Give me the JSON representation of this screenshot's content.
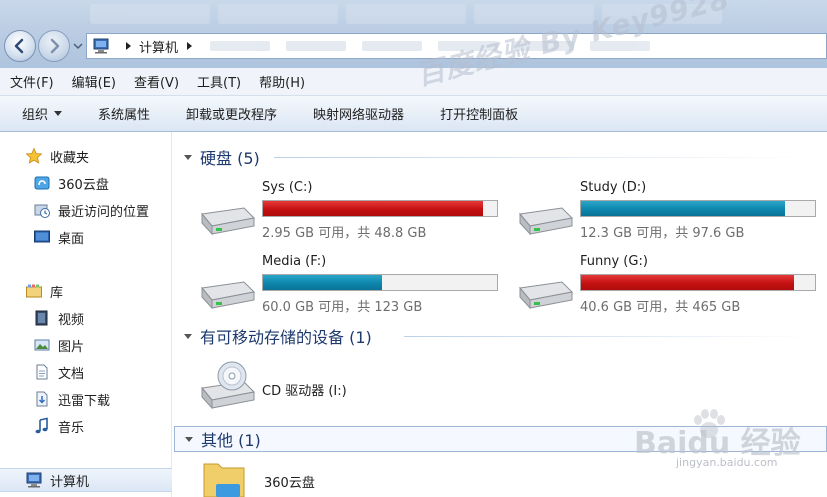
{
  "window": {
    "address": {
      "location": "计算机"
    }
  },
  "menu": [
    "文件(F)",
    "编辑(E)",
    "查看(V)",
    "工具(T)",
    "帮助(H)"
  ],
  "commands": {
    "organize": "组织",
    "system_properties": "系统属性",
    "uninstall": "卸载或更改程序",
    "map_drive": "映射网络驱动器",
    "control_panel": "打开控制面板"
  },
  "nav": {
    "favorites": {
      "label": "收藏夹",
      "items": [
        "360云盘",
        "最近访问的位置",
        "桌面"
      ]
    },
    "libraries": {
      "label": "库",
      "items": [
        "视频",
        "图片",
        "文档",
        "迅雷下载",
        "音乐"
      ]
    },
    "computer": "计算机"
  },
  "groups": {
    "hard_disks": {
      "title": "硬盘 (5)",
      "drives": [
        {
          "name": "Sys (C:)",
          "info": "2.95 GB 可用，共 48.8 GB",
          "used_fraction": 0.94,
          "color": "red"
        },
        {
          "name": "Study (D:)",
          "info": "12.3 GB 可用，共 97.6 GB",
          "used_fraction": 0.87,
          "color": "teal"
        },
        {
          "name": "Media (F:)",
          "info": "60.0 GB 可用，共 123 GB",
          "used_fraction": 0.51,
          "color": "teal"
        },
        {
          "name": "Funny (G:)",
          "info": "40.6 GB 可用，共 465 GB",
          "used_fraction": 0.91,
          "color": "red"
        }
      ]
    },
    "removable": {
      "title": "有可移动存储的设备 (1)",
      "item": "CD 驱动器 (I:)"
    },
    "other": {
      "title": "其他 (1)",
      "item": "360云盘"
    }
  },
  "watermarks": {
    "top": "百度经验 By Key9928",
    "baidu": "Baidu 经验",
    "url": "jingyan.baidu.com"
  },
  "colors": {
    "bar_red": "#c41111",
    "bar_teal": "#0e86ad",
    "group_title": "#1e3a6e"
  }
}
